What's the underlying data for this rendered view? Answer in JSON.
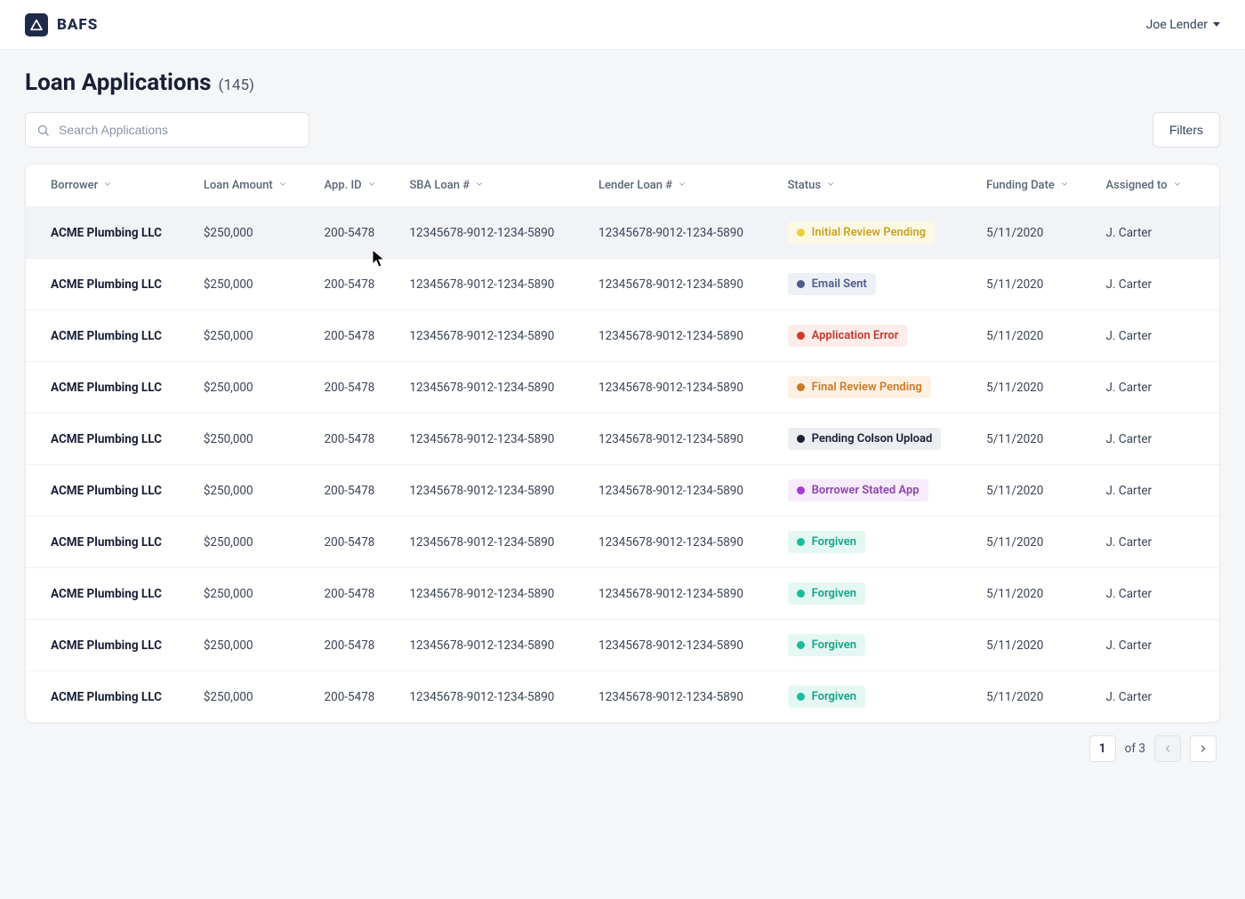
{
  "brand": {
    "name": "BAFS"
  },
  "user": {
    "name": "Joe Lender"
  },
  "page": {
    "title": "Loan Applications",
    "count": "(145)"
  },
  "search": {
    "placeholder": "Search Applications"
  },
  "filters_button": "Filters",
  "columns": [
    {
      "key": "borrower",
      "label": "Borrower"
    },
    {
      "key": "amount",
      "label": "Loan Amount"
    },
    {
      "key": "app_id",
      "label": "App. ID"
    },
    {
      "key": "sba_loan",
      "label": "SBA Loan #"
    },
    {
      "key": "lender_loan",
      "label": "Lender Loan #"
    },
    {
      "key": "status",
      "label": "Status"
    },
    {
      "key": "funding_date",
      "label": "Funding Date"
    },
    {
      "key": "assigned_to",
      "label": "Assigned to"
    }
  ],
  "status_styles": {
    "Initial Review Pending": {
      "bg": "#fdf8e4",
      "dot": "#e6d13a",
      "text": "#c9a227"
    },
    "Email Sent": {
      "bg": "#edf0f7",
      "dot": "#4a5d8a",
      "text": "#4a5d8a"
    },
    "Application Error": {
      "bg": "#fdecea",
      "dot": "#d13b2a",
      "text": "#c0392b"
    },
    "Final Review Pending": {
      "bg": "#fdf1e4",
      "dot": "#c97b27",
      "text": "#c97b27"
    },
    "Pending Colson Upload": {
      "bg": "#eceef1",
      "dot": "#1a1f36",
      "text": "#1a1f36"
    },
    "Borrower Stated App": {
      "bg": "#f6ecfb",
      "dot": "#a63bd1",
      "text": "#8e44ad"
    },
    "Forgiven": {
      "bg": "#e4f7f3",
      "dot": "#1abc9c",
      "text": "#11a587"
    }
  },
  "rows": [
    {
      "borrower": "ACME Plumbing LLC",
      "amount": "$250,000",
      "app_id": "200-5478",
      "sba_loan": "12345678-9012-1234-5890",
      "lender_loan": "12345678-9012-1234-5890",
      "status": "Initial Review Pending",
      "funding_date": "5/11/2020",
      "assigned_to": "J. Carter",
      "hovered": true
    },
    {
      "borrower": "ACME Plumbing LLC",
      "amount": "$250,000",
      "app_id": "200-5478",
      "sba_loan": "12345678-9012-1234-5890",
      "lender_loan": "12345678-9012-1234-5890",
      "status": "Email Sent",
      "funding_date": "5/11/2020",
      "assigned_to": "J. Carter"
    },
    {
      "borrower": "ACME Plumbing LLC",
      "amount": "$250,000",
      "app_id": "200-5478",
      "sba_loan": "12345678-9012-1234-5890",
      "lender_loan": "12345678-9012-1234-5890",
      "status": "Application Error",
      "funding_date": "5/11/2020",
      "assigned_to": "J. Carter"
    },
    {
      "borrower": "ACME Plumbing LLC",
      "amount": "$250,000",
      "app_id": "200-5478",
      "sba_loan": "12345678-9012-1234-5890",
      "lender_loan": "12345678-9012-1234-5890",
      "status": "Final Review Pending",
      "funding_date": "5/11/2020",
      "assigned_to": "J. Carter"
    },
    {
      "borrower": "ACME Plumbing LLC",
      "amount": "$250,000",
      "app_id": "200-5478",
      "sba_loan": "12345678-9012-1234-5890",
      "lender_loan": "12345678-9012-1234-5890",
      "status": "Pending Colson Upload",
      "funding_date": "5/11/2020",
      "assigned_to": "J. Carter"
    },
    {
      "borrower": "ACME Plumbing LLC",
      "amount": "$250,000",
      "app_id": "200-5478",
      "sba_loan": "12345678-9012-1234-5890",
      "lender_loan": "12345678-9012-1234-5890",
      "status": "Borrower Stated App",
      "funding_date": "5/11/2020",
      "assigned_to": "J. Carter"
    },
    {
      "borrower": "ACME Plumbing LLC",
      "amount": "$250,000",
      "app_id": "200-5478",
      "sba_loan": "12345678-9012-1234-5890",
      "lender_loan": "12345678-9012-1234-5890",
      "status": "Forgiven",
      "funding_date": "5/11/2020",
      "assigned_to": "J. Carter"
    },
    {
      "borrower": "ACME Plumbing LLC",
      "amount": "$250,000",
      "app_id": "200-5478",
      "sba_loan": "12345678-9012-1234-5890",
      "lender_loan": "12345678-9012-1234-5890",
      "status": "Forgiven",
      "funding_date": "5/11/2020",
      "assigned_to": "J. Carter"
    },
    {
      "borrower": "ACME Plumbing LLC",
      "amount": "$250,000",
      "app_id": "200-5478",
      "sba_loan": "12345678-9012-1234-5890",
      "lender_loan": "12345678-9012-1234-5890",
      "status": "Forgiven",
      "funding_date": "5/11/2020",
      "assigned_to": "J. Carter"
    },
    {
      "borrower": "ACME Plumbing LLC",
      "amount": "$250,000",
      "app_id": "200-5478",
      "sba_loan": "12345678-9012-1234-5890",
      "lender_loan": "12345678-9012-1234-5890",
      "status": "Forgiven",
      "funding_date": "5/11/2020",
      "assigned_to": "J. Carter"
    }
  ],
  "pagination": {
    "current": "1",
    "of_label": "of 3"
  }
}
